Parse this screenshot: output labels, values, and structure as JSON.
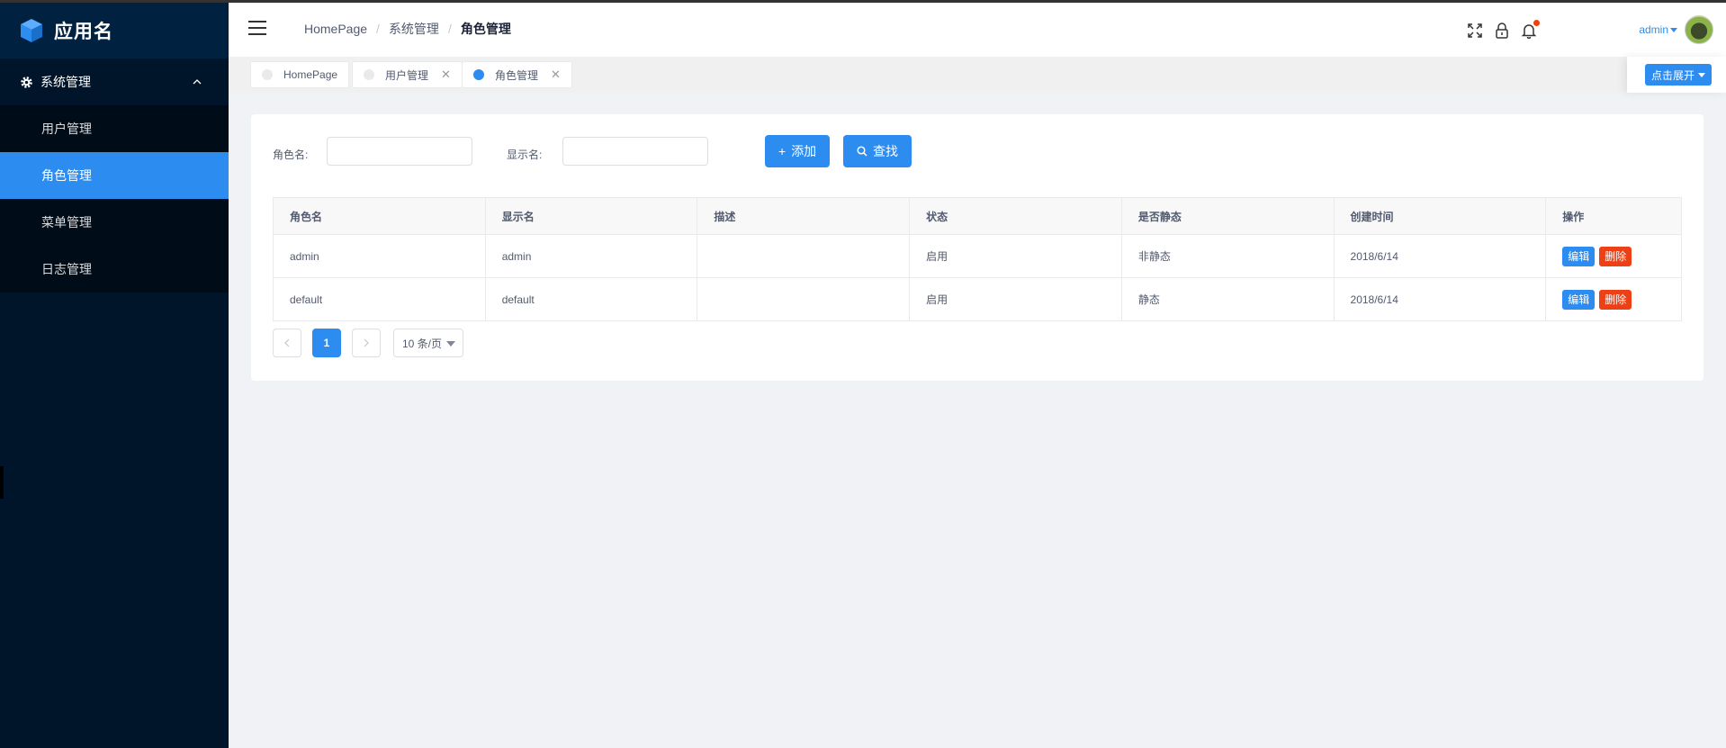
{
  "app": {
    "name": "应用名",
    "logo_icon": "cube-icon"
  },
  "sidebar": {
    "group": {
      "label": "系统管理",
      "icon": "gear-icon",
      "expanded": true
    },
    "items": [
      {
        "label": "用户管理",
        "active": false
      },
      {
        "label": "角色管理",
        "active": true
      },
      {
        "label": "菜单管理",
        "active": false
      },
      {
        "label": "日志管理",
        "active": false
      }
    ]
  },
  "header": {
    "breadcrumb": [
      "HomePage",
      "系统管理",
      "角色管理"
    ],
    "icons": [
      "fullscreen-icon",
      "lock-icon",
      "bell-icon"
    ],
    "username": "admin"
  },
  "tags": [
    {
      "label": "HomePage",
      "closable": false,
      "active": false
    },
    {
      "label": "用户管理",
      "closable": true,
      "active": false
    },
    {
      "label": "角色管理",
      "closable": true,
      "active": true
    }
  ],
  "tags_expand_label": "点击展开",
  "search": {
    "role_label": "角色名:",
    "role_value": "",
    "display_label": "显示名:",
    "display_value": "",
    "add_label": "添加",
    "search_label": "查找"
  },
  "table": {
    "columns": [
      "角色名",
      "显示名",
      "描述",
      "状态",
      "是否静态",
      "创建时间",
      "操作"
    ],
    "rows": [
      {
        "role": "admin",
        "display": "admin",
        "desc": "",
        "status": "启用",
        "static": "非静态",
        "created": "2018/6/14"
      },
      {
        "role": "default",
        "display": "default",
        "desc": "",
        "status": "启用",
        "static": "静态",
        "created": "2018/6/14"
      }
    ],
    "edit_label": "编辑",
    "delete_label": "删除"
  },
  "pagination": {
    "current": "1",
    "page_size": "10 条/页"
  },
  "colors": {
    "primary": "#2d8cf0",
    "danger": "#ed4014",
    "sidebar_bg": "#001529"
  }
}
